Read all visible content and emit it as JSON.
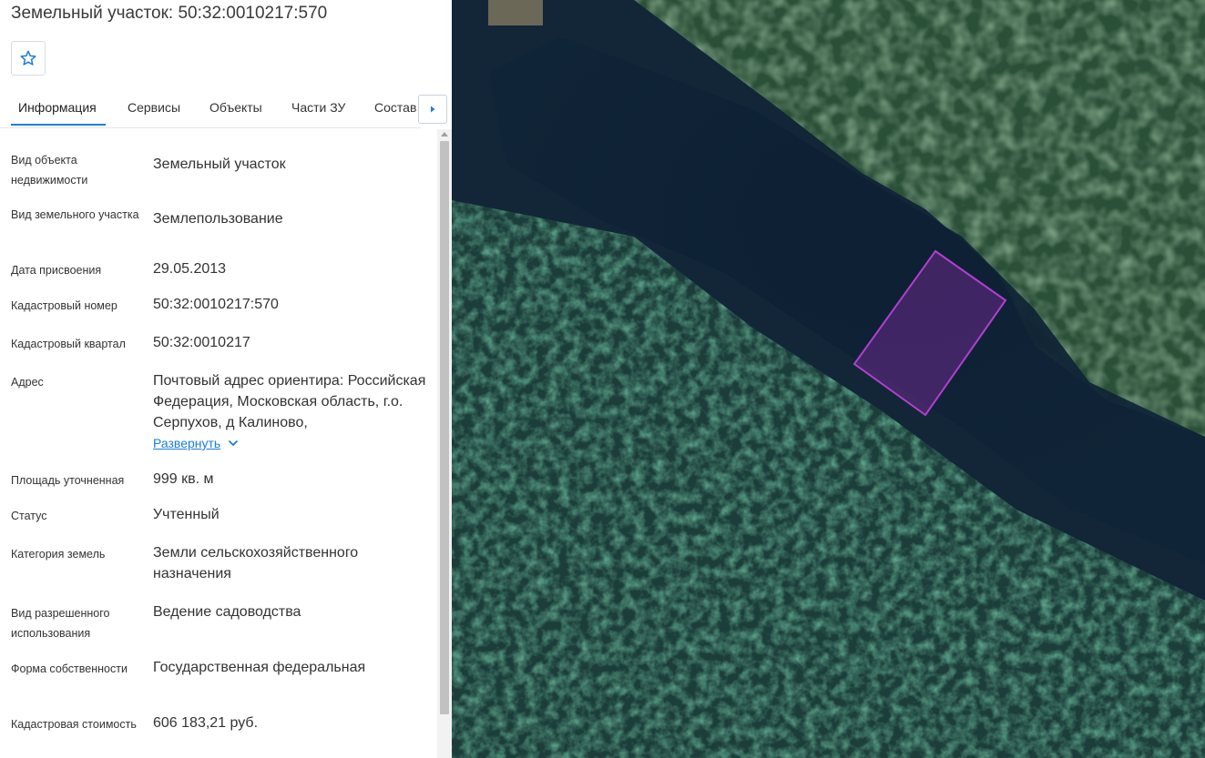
{
  "header": {
    "title": "Земельный участок: 50:32:0010217:570"
  },
  "tabs": [
    {
      "label": "Информация"
    },
    {
      "label": "Сервисы"
    },
    {
      "label": "Объекты"
    },
    {
      "label": "Части ЗУ"
    },
    {
      "label": "Состав"
    }
  ],
  "info": {
    "rows": [
      {
        "label": "Вид объекта недвижимости",
        "value": "Земельный участок"
      },
      {
        "label": "Вид земельного участка",
        "value": "Землепользование"
      },
      {
        "label": "Дата присвоения",
        "value": "29.05.2013"
      },
      {
        "label": "Кадастровый номер",
        "value": "50:32:0010217:570"
      },
      {
        "label": "Кадастровый квартал",
        "value": "50:32:0010217"
      },
      {
        "label": "Адрес",
        "value": "Почтовый адрес ориентира: Российская Федерация, Московская область, г.о. Серпухов, д Калиново,",
        "expand_label": "Развернуть"
      },
      {
        "label": "Площадь уточненная",
        "value": "999 кв. м"
      },
      {
        "label": "Статус",
        "value": "Учтенный"
      },
      {
        "label": "Категория земель",
        "value": "Земли сельскохозяйственного назначения"
      },
      {
        "label": "Вид разрешенного использования",
        "value": "Ведение садоводства"
      },
      {
        "label": "Форма собственности",
        "value": "Государственная федеральная"
      },
      {
        "label": "Кадастровая стоимость",
        "value": "606 183,21 руб."
      }
    ]
  },
  "icons": {
    "favorite": "star-outline-icon",
    "tabs_next": "caret-right-icon",
    "expand": "chevron-down-icon"
  },
  "colors": {
    "accent": "#1e7fd8",
    "parcel_outline": "#b23fd1",
    "parcel_fill": "#6a2a8a"
  }
}
